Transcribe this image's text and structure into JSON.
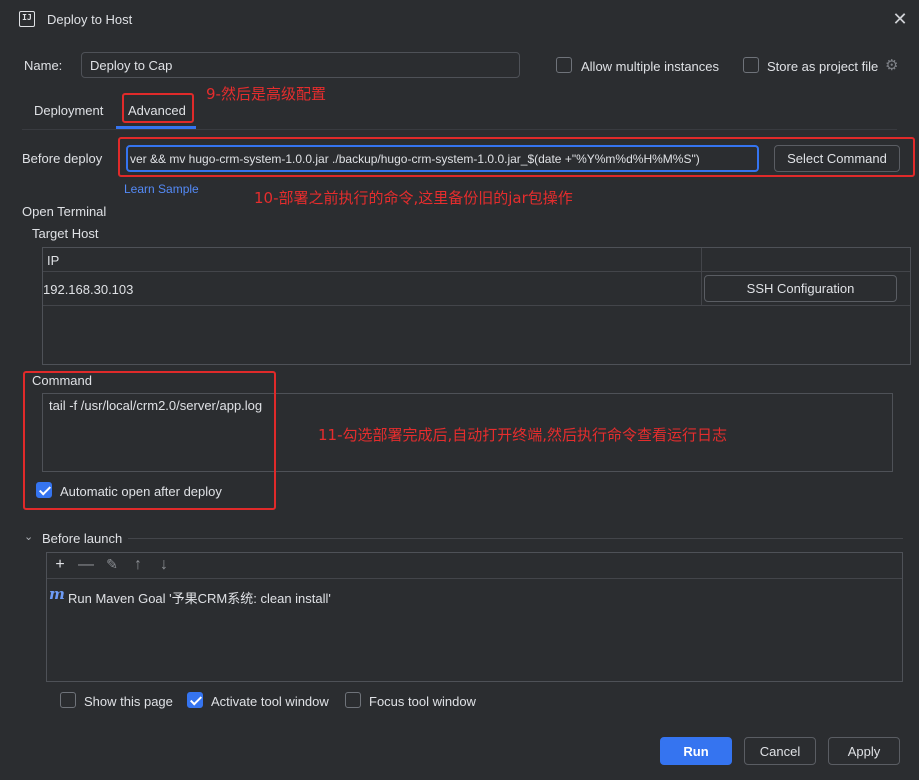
{
  "window": {
    "logo": "IJ",
    "title": "Deploy to Host",
    "close_glyph": "✕"
  },
  "name_row": {
    "label": "Name:",
    "value": "Deploy to Cap",
    "allow_multiple_label": "Allow multiple instances",
    "allow_multiple_checked": false,
    "store_project_label": "Store as project file",
    "store_project_checked": false,
    "gear_glyph": "⚙"
  },
  "tabs": [
    {
      "label": "Deployment",
      "selected": false
    },
    {
      "label": "Advanced",
      "selected": true
    }
  ],
  "annotations": {
    "a9": "9-然后是高级配置",
    "a10": "10-部署之前执行的命令,这里备份旧的jar包操作",
    "a11": "11-勾选部署完成后,自动打开终端,然后执行命令查看运行日志"
  },
  "before_deploy": {
    "label": "Before deploy",
    "command_value": "ver && mv hugo-crm-system-1.0.0.jar ./backup/hugo-crm-system-1.0.0.jar_$(date +\"%Y%m%d%H%M%S\")",
    "select_command_label": "Select Command",
    "learn_sample_label": "Learn Sample"
  },
  "open_terminal": {
    "label": "Open Terminal",
    "target_host_label": "Target Host",
    "table": {
      "headers": [
        "IP",
        ""
      ],
      "rows": [
        {
          "ip": "192.168.30.103",
          "action_label": "SSH Configuration"
        }
      ]
    },
    "command_label": "Command",
    "command_value": "tail -f /usr/local/crm2.0/server/app.log",
    "auto_open_label": "Automatic open after deploy",
    "auto_open_checked": true
  },
  "before_launch": {
    "label": "Before launch",
    "toolbar": [
      "+",
      "—",
      "✎",
      "↑",
      "↓"
    ],
    "items": [
      {
        "icon": "m",
        "text": "Run Maven Goal '予果CRM系统: clean install'"
      }
    ]
  },
  "options": {
    "show_page_label": "Show this page",
    "show_page_checked": false,
    "activate_tool_label": "Activate tool window",
    "activate_tool_checked": true,
    "focus_tool_label": "Focus tool window",
    "focus_tool_checked": false
  },
  "footer": {
    "run_label": "Run",
    "cancel_label": "Cancel",
    "apply_label": "Apply"
  },
  "colors": {
    "background": "#2b2d30",
    "accent": "#3574f0",
    "annotation": "#e02a2a",
    "link": "#548af7"
  }
}
